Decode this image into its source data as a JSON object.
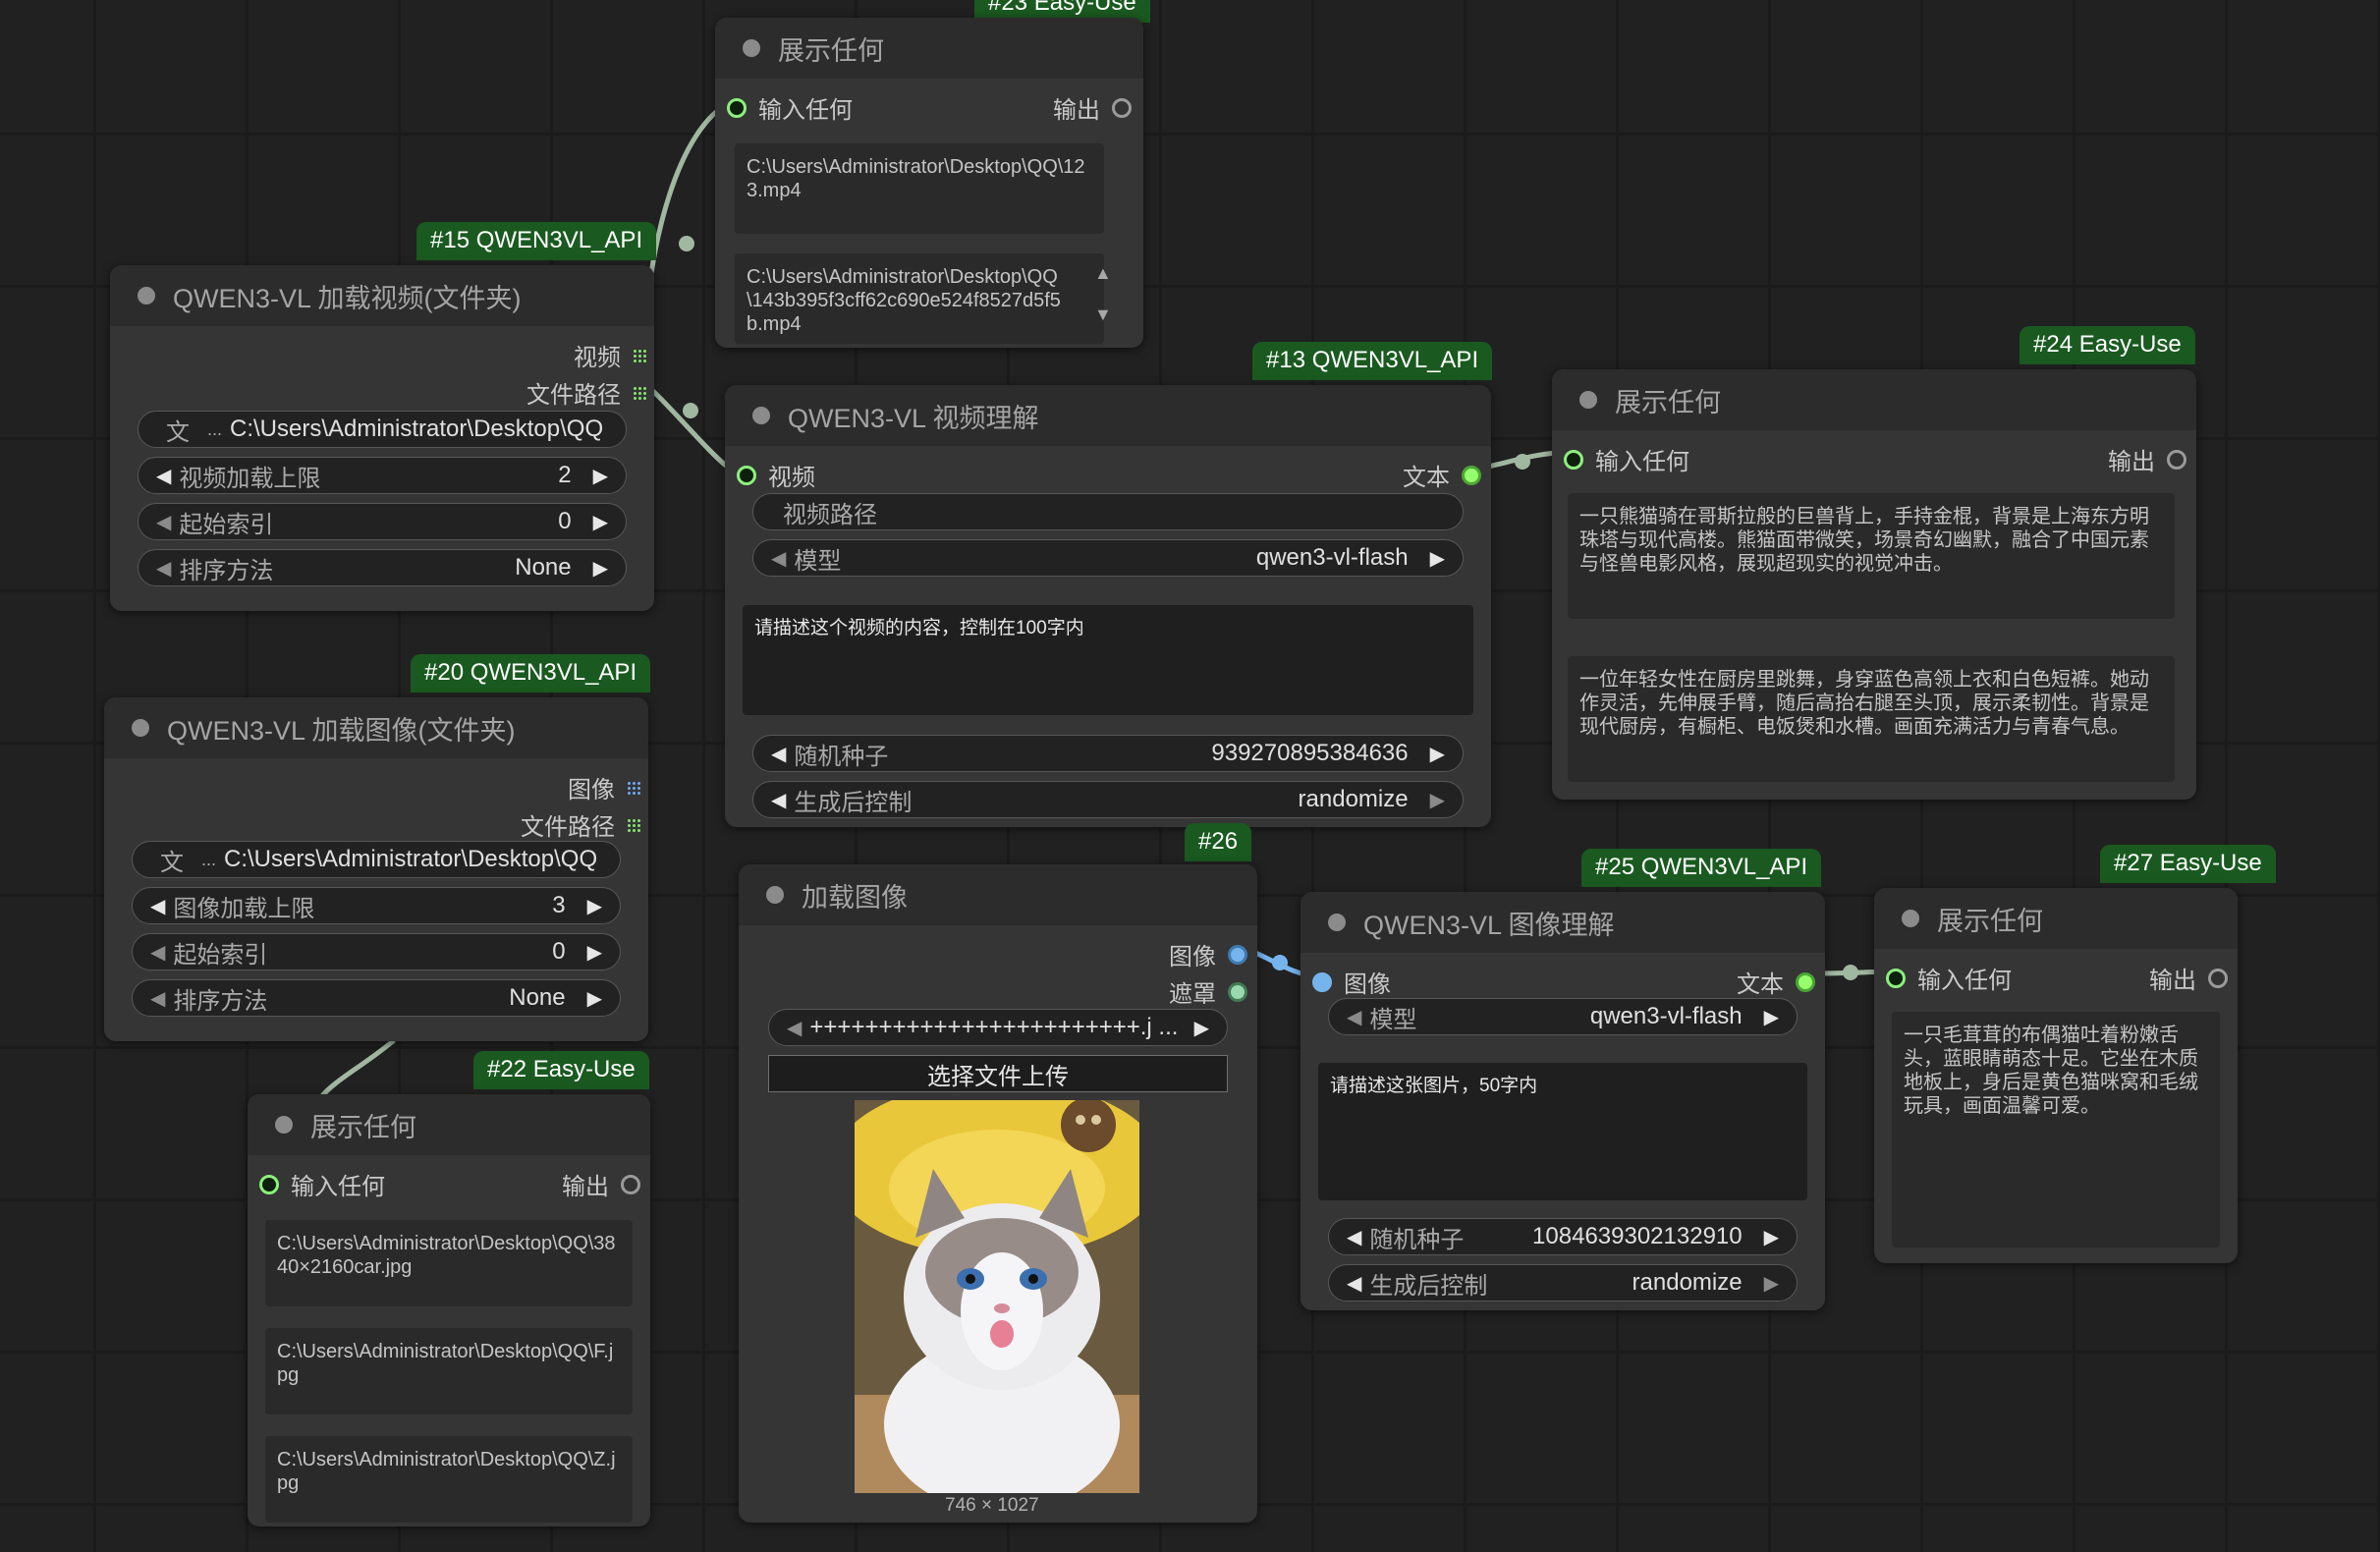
{
  "theme": {
    "wire": "#a0b7a0",
    "badge": "#1a5a20",
    "slot_green": "#8cf07c",
    "slot_blue": "#76b4ee"
  },
  "nodes": {
    "show_top": {
      "badge": "#23 Easy-Use",
      "title": "展示任何",
      "input": "输入任何",
      "output": "输出",
      "texts": [
        "C:\\Users\\Administrator\\Desktop\\QQ\\123.mp4",
        "C:\\Users\\Administrator\\Desktop\\QQ\\143b395f3cff62c690e524f8527d5f5b.mp4"
      ]
    },
    "n15": {
      "badge": "#15 QWEN3VL_API",
      "title": "QWEN3-VL 加载视频(文件夹)",
      "out1": "视频",
      "out2": "文件路径",
      "folder_prefix": "文",
      "folder_value": "C:\\Users\\Administrator\\Desktop\\QQ",
      "w1_label": "视频加载上限",
      "w1_value": "2",
      "w2_label": "起始索引",
      "w2_value": "0",
      "w3_label": "排序方法",
      "w3_value": "None"
    },
    "n13": {
      "badge": "#13 QWEN3VL_API",
      "title": "QWEN3-VL 视频理解",
      "input": "视频",
      "output": "文本",
      "path_widget": "视频路径",
      "model_label": "模型",
      "model_value": "qwen3-vl-flash",
      "prompt": "请描述这个视频的内容，控制在100字内",
      "seed_label": "随机种子",
      "seed_value": "939270895384636",
      "ctrl_label": "生成后控制",
      "ctrl_value": "randomize"
    },
    "n24": {
      "badge": "#24 Easy-Use",
      "title": "展示任何",
      "input": "输入任何",
      "output": "输出",
      "texts": [
        "一只熊猫骑在哥斯拉般的巨兽背上，手持金棍，背景是上海东方明珠塔与现代高楼。熊猫面带微笑，场景奇幻幽默，融合了中国元素与怪兽电影风格，展现超现实的视觉冲击。",
        "一位年轻女性在厨房里跳舞，身穿蓝色高领上衣和白色短裤。她动作灵活，先伸展手臂，随后高抬右腿至头顶，展示柔韧性。背景是现代厨房，有橱柜、电饭煲和水槽。画面充满活力与青春气息。"
      ]
    },
    "n20": {
      "badge": "#20 QWEN3VL_API",
      "title": "QWEN3-VL 加载图像(文件夹)",
      "out1": "图像",
      "out2": "文件路径",
      "folder_prefix": "文",
      "folder_value": "C:\\Users\\Administrator\\Desktop\\QQ",
      "w1_label": "图像加载上限",
      "w1_value": "3",
      "w2_label": "起始索引",
      "w2_value": "0",
      "w3_label": "排序方法",
      "w3_value": "None"
    },
    "n26": {
      "badge": "#26",
      "title": "加载图像",
      "out1": "图像",
      "out2": "遮罩",
      "file_value": "++++++++++++++++++++++++.j ...",
      "upload": "选择文件上传",
      "image_size": "746 × 1027"
    },
    "n25": {
      "badge": "#25 QWEN3VL_API",
      "title": "QWEN3-VL 图像理解",
      "input": "图像",
      "output": "文本",
      "model_label": "模型",
      "model_value": "qwen3-vl-flash",
      "prompt": "请描述这张图片，50字内",
      "seed_label": "随机种子",
      "seed_value": "1084639302132910",
      "ctrl_label": "生成后控制",
      "ctrl_value": "randomize"
    },
    "n27": {
      "badge": "#27 Easy-Use",
      "title": "展示任何",
      "input": "输入任何",
      "output": "输出",
      "text": "一只毛茸茸的布偶猫吐着粉嫩舌头，蓝眼睛萌态十足。它坐在木质地板上，身后是黄色猫咪窝和毛绒玩具，画面温馨可爱。"
    },
    "n22": {
      "badge": "#22 Easy-Use",
      "title": "展示任何",
      "input": "输入任何",
      "output": "输出",
      "texts": [
        "C:\\Users\\Administrator\\Desktop\\QQ\\3840×2160car.jpg",
        "C:\\Users\\Administrator\\Desktop\\QQ\\F.jpg",
        "C:\\Users\\Administrator\\Desktop\\QQ\\Z.jpg"
      ]
    }
  }
}
